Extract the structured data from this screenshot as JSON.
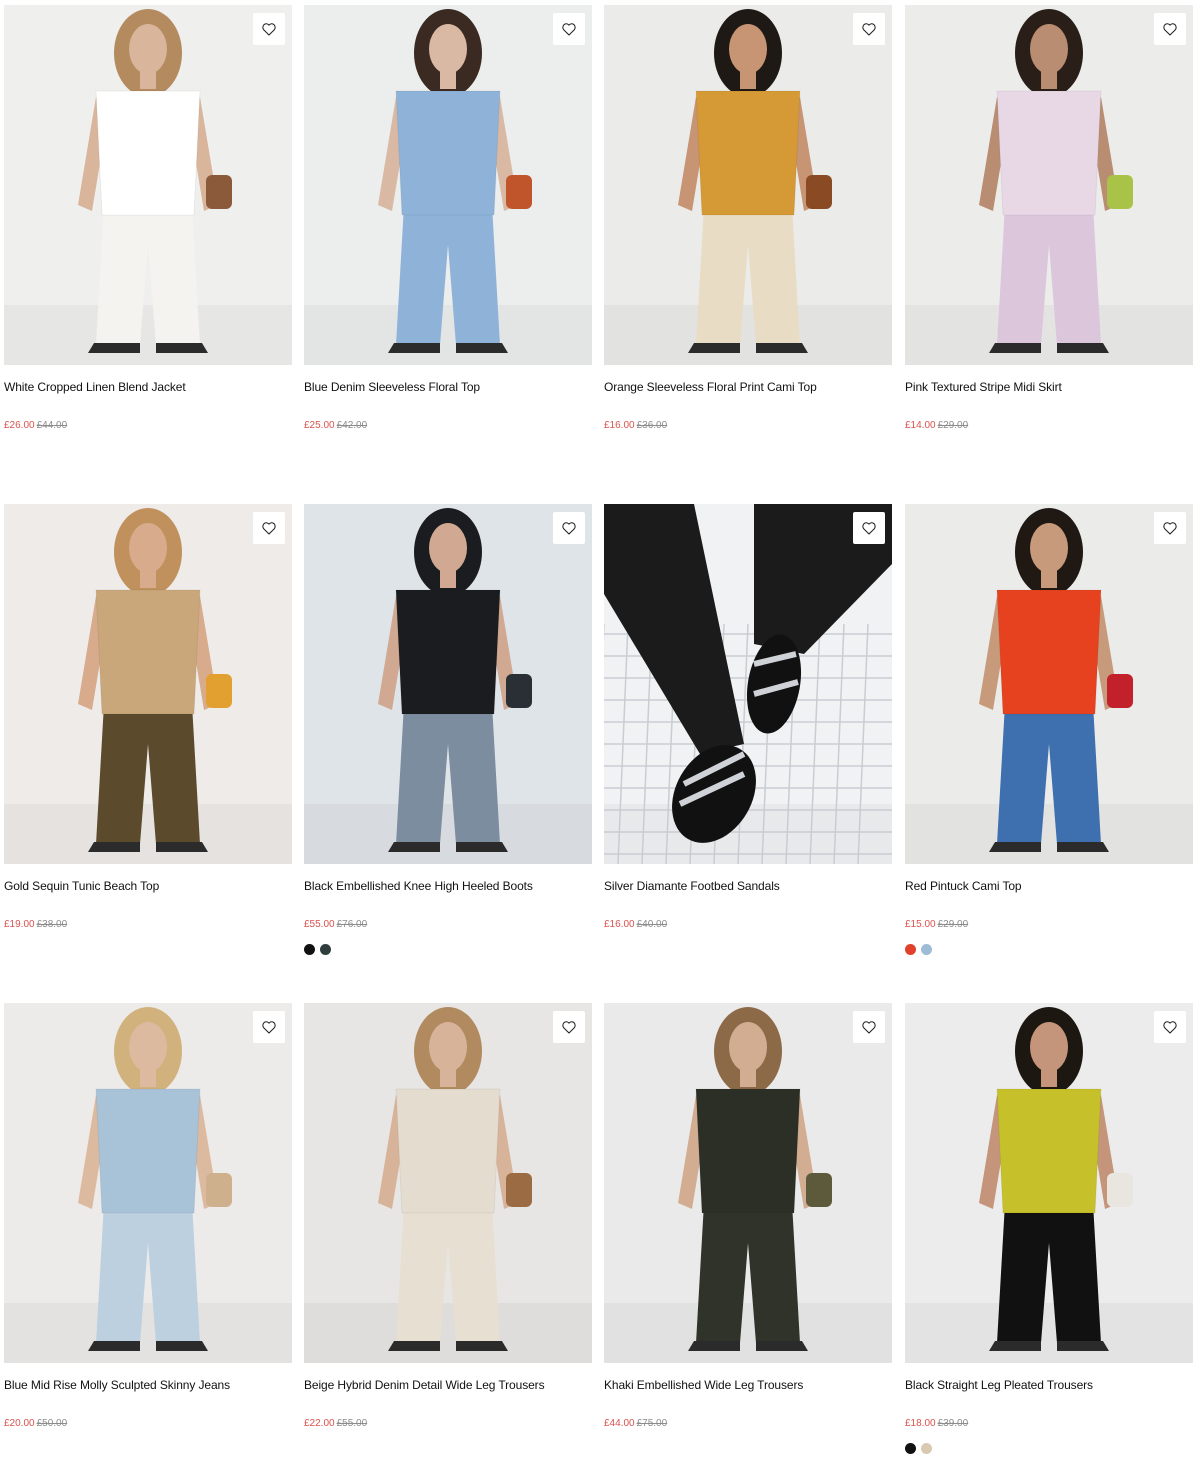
{
  "products": [
    {
      "name": "White Cropped Linen Blend Jacket",
      "price_now": "£26.00",
      "price_was": "£44.00",
      "swatches": [],
      "bg": "#efefee",
      "top": "#ffffff",
      "bottom": "#f4f3ef",
      "skin": "#d8b59b",
      "hair": "#b38b5e",
      "accent": "#8a5a3a"
    },
    {
      "name": "Blue Denim Sleeveless Floral Top",
      "price_now": "£25.00",
      "price_was": "£42.00",
      "swatches": [],
      "bg": "#eceded",
      "top": "#8fb3d8",
      "bottom": "#8fb3d8",
      "skin": "#d9b9a4",
      "hair": "#3a2a22",
      "accent": "#c0542a"
    },
    {
      "name": "Orange Sleeveless Floral Print Cami Top",
      "price_now": "£16.00",
      "price_was": "£36.00",
      "swatches": [],
      "bg": "#ebebea",
      "top": "#d59a36",
      "bottom": "#e9dcc5",
      "skin": "#c79474",
      "hair": "#1f1915",
      "accent": "#8a4a24"
    },
    {
      "name": "Pink Textured Stripe Midi Skirt",
      "price_now": "£14.00",
      "price_was": "£29.00",
      "swatches": [],
      "bg": "#ececeb",
      "top": "#e8d8e6",
      "bottom": "#dcc6dc",
      "skin": "#b98d72",
      "hair": "#2a1e18",
      "accent": "#a9c248"
    },
    {
      "name": "Gold Sequin Tunic Beach Top",
      "price_now": "£19.00",
      "price_was": "£38.00",
      "swatches": [],
      "bg": "#eeebe9",
      "top": "#c9a77a",
      "bottom": "#5b4a2c",
      "skin": "#d7ab8c",
      "hair": "#c0915d",
      "accent": "#e2a030"
    },
    {
      "name": "Black Embellished Knee High Heeled Boots",
      "price_now": "£55.00",
      "price_was": "£76.00",
      "swatches": [
        "#111111",
        "#2f3d3d"
      ],
      "bg": "#dfe4e8",
      "top": "#1a1c20",
      "bottom": "#7d8da0",
      "skin": "#d1a891",
      "hair": "#1a1c20",
      "accent": "#2a2e35"
    },
    {
      "name": "Silver Diamante Footbed Sandals",
      "price_now": "£16.00",
      "price_was": "£40.00",
      "swatches": [],
      "bg": "#f1f2f4",
      "top": "#1b1b1c",
      "bottom": "#1b1b1c",
      "skin": "#e4c4ad",
      "hair": "#1b1b1c",
      "accent": "#cfd3d8"
    },
    {
      "name": "Red Pintuck Cami Top",
      "price_now": "£15.00",
      "price_was": "£29.00",
      "swatches": [
        "#e0412a",
        "#9fbcd6"
      ],
      "bg": "#ebebea",
      "top": "#e6421f",
      "bottom": "#3e6fae",
      "skin": "#c79a7c",
      "hair": "#1f1813",
      "accent": "#c2202a"
    },
    {
      "name": "Blue Mid Rise Molly Sculpted Skinny Jeans",
      "price_now": "£20.00",
      "price_was": "£50.00",
      "swatches": [],
      "bg": "#ecebea",
      "top": "#a8c2d8",
      "bottom": "#bcd0e0",
      "skin": "#dcbaa0",
      "hair": "#d2b27c",
      "accent": "#cfb08c"
    },
    {
      "name": "Beige Hybrid Denim Detail Wide Leg Trousers",
      "price_now": "£22.00",
      "price_was": "£55.00",
      "swatches": [],
      "bg": "#e7e6e4",
      "top": "#e4ddcf",
      "bottom": "#e7e0d2",
      "skin": "#d7b39a",
      "hair": "#b18a60",
      "accent": "#9b6c43"
    },
    {
      "name": "Khaki Embellished Wide Leg Trousers",
      "price_now": "£44.00",
      "price_was": "£75.00",
      "swatches": [],
      "bg": "#eaeaea",
      "top": "#2c2f26",
      "bottom": "#2f3329",
      "skin": "#d3ad92",
      "hair": "#8c6a48",
      "accent": "#5c5a3a"
    },
    {
      "name": "Black Straight Leg Pleated Trousers",
      "price_now": "£18.00",
      "price_was": "£39.00",
      "swatches": [
        "#111111",
        "#d9c9b0"
      ],
      "bg": "#ececec",
      "top": "#c6c02a",
      "bottom": "#111111",
      "skin": "#c4957a",
      "hair": "#1d1712",
      "accent": "#e9e6e0"
    }
  ]
}
